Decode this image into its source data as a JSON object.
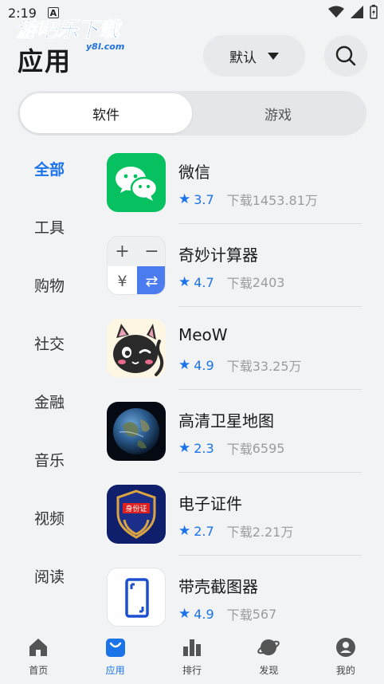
{
  "status_bar": {
    "time": "2:19",
    "notif_glyph": "A"
  },
  "watermark": {
    "line1": "游吧乐下载",
    "line2": "y8l.com"
  },
  "header": {
    "title": "应用",
    "sort_label": "默认",
    "search_icon": "search-icon"
  },
  "segment": {
    "active": "软件",
    "inactive": "游戏"
  },
  "categories": [
    "全部",
    "工具",
    "购物",
    "社交",
    "金融",
    "音乐",
    "视频",
    "阅读"
  ],
  "apps": [
    {
      "name": "微信",
      "rating": "3.7",
      "downloads_label": "下载",
      "downloads": "1453.81万"
    },
    {
      "name": "奇妙计算器",
      "rating": "4.7",
      "downloads_label": "下载",
      "downloads": "2403"
    },
    {
      "name": "MeoW",
      "rating": "4.9",
      "downloads_label": "下载",
      "downloads": "33.25万"
    },
    {
      "name": "高清卫星地图",
      "rating": "2.3",
      "downloads_label": "下载",
      "downloads": "6595"
    },
    {
      "name": "电子证件",
      "rating": "2.7",
      "downloads_label": "下载",
      "downloads": "2.21万"
    },
    {
      "name": "带壳截图器",
      "rating": "4.9",
      "downloads_label": "下载",
      "downloads": "567"
    }
  ],
  "icon_text": {
    "calc_plus": "+",
    "calc_minus": "−",
    "calc_yen": "¥",
    "calc_swap": "⇄",
    "id_badge": "身份证"
  },
  "bottom_nav": [
    {
      "label": "首页",
      "icon": "home-icon"
    },
    {
      "label": "应用",
      "icon": "app-store-icon"
    },
    {
      "label": "排行",
      "icon": "ranking-icon"
    },
    {
      "label": "发现",
      "icon": "discover-icon"
    },
    {
      "label": "我的",
      "icon": "profile-icon"
    }
  ],
  "colors": {
    "accent": "#1a73e8",
    "wechat_green": "#07c160",
    "background": "#f2f3f5"
  }
}
